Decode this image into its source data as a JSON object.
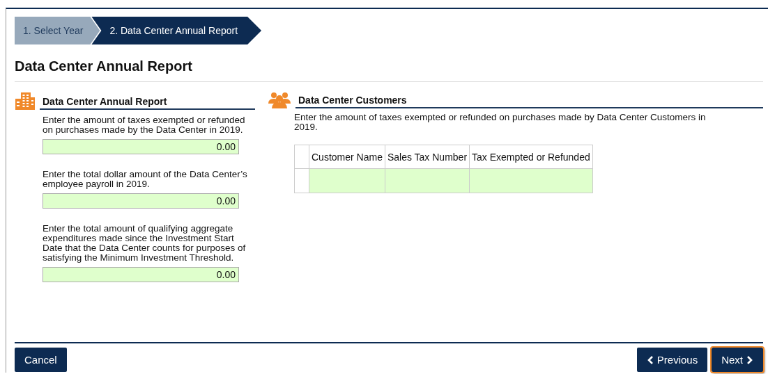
{
  "steps": [
    {
      "label": "1. Select Year",
      "selected": false
    },
    {
      "label": "2. Data Center Annual Report",
      "selected": true
    }
  ],
  "title": "Data Center Annual Report",
  "report_section": {
    "heading": "Data Center Annual Report",
    "fields": [
      {
        "label": "Enter the amount of taxes exempted or refunded on purchases made by the Data Center in 2019.",
        "value": "0.00"
      },
      {
        "label": "Enter the total dollar amount of the Data Center’s employee payroll in 2019.",
        "value": "0.00"
      },
      {
        "label": "Enter the total amount of qualifying aggregate expenditures made since the Investment Start Date that the Data Center counts for purposes of satisfying the Minimum Investment Threshold.",
        "value": "0.00"
      }
    ]
  },
  "customers_section": {
    "heading": "Data Center Customers",
    "instructions": "Enter the amount of taxes exempted or refunded on purchases made by Data Center Customers in 2019.",
    "table": {
      "columns": [
        "Customer Name",
        "Sales Tax Number",
        "Tax Exempted or Refunded"
      ],
      "rows": [
        {
          "selected": false
        }
      ]
    }
  },
  "buttons": [
    {
      "label": "Cancel",
      "kind": "cancel",
      "focused": false
    },
    {
      "label": "Previous",
      "kind": "previous",
      "focused": false
    },
    {
      "label": "Next",
      "kind": "next",
      "focused": true
    }
  ]
}
